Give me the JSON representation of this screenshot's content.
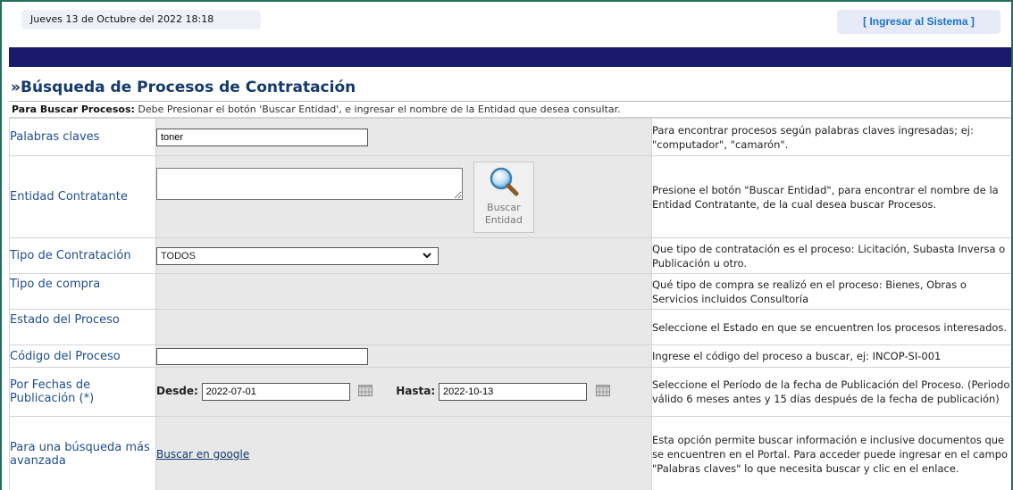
{
  "header": {
    "date_time": "Jueves 13 de Octubre del 2022 18:18",
    "login_label": "[ Ingresar al Sistema ]"
  },
  "page": {
    "title": "»Búsqueda de Procesos de Contratación",
    "instruction_bold": "Para Buscar Procesos:",
    "instruction_text": " Debe Presionar el botón 'Buscar Entidad', e ingresar el nombre de la Entidad que desea consultar."
  },
  "form": {
    "keywords": {
      "label": "Palabras claves",
      "value": "toner",
      "help": "Para encontrar procesos según palabras claves ingresadas; ej: \"computador\", \"camarón\"."
    },
    "entity": {
      "label": "Entidad Contratante",
      "value": "",
      "button_line1": "Buscar",
      "button_line2": "Entidad",
      "help": "Presione el botón \"Buscar Entidad\", para encontrar el nombre de la Entidad Contratante, de la cual desea buscar Procesos."
    },
    "contract_type": {
      "label": "Tipo de Contratación",
      "selected": "TODOS",
      "help": "Que tipo de contratación es el proceso: Licitación, Subasta Inversa o Publicación u otro."
    },
    "purchase_type": {
      "label": "Tipo de compra",
      "help": "Qué tipo de compra se realizó en el proceso: Bienes, Obras o Servicios incluidos Consultoría"
    },
    "process_state": {
      "label": "Estado del Proceso",
      "help": "Seleccione el Estado en que se encuentren los procesos interesados."
    },
    "process_code": {
      "label": "Código del Proceso",
      "value": "",
      "help": "Ingrese el código del proceso a buscar, ej: INCOP-SI-001"
    },
    "dates": {
      "label": "Por Fechas de Publicación (*)",
      "from_label": "Desde:",
      "from_value": "2022-07-01",
      "to_label": "Hasta:",
      "to_value": "2022-10-13",
      "help": "Seleccione el Período de la fecha de Publicación del Proceso. (Periodo válido 6 meses antes y 15 días después de la fecha de publicación)"
    },
    "advanced": {
      "label": "Para una búsqueda más avanzada",
      "link": "Buscar en google",
      "help": "Esta opción permite buscar información e inclusive documentos que se encuentren en el Portal. Para acceder puede ingresar en el campo \"Palabras claves\" lo que necesita buscar y clic en el enlace."
    }
  },
  "icons": {
    "search": "magnifier-icon",
    "calendar": "calendar-icon",
    "dropdown": "chevron-down-icon"
  },
  "colors": {
    "navbar": "#191970",
    "title": "#143a6e",
    "label": "#1f4e8c",
    "login": "#1a73c9",
    "control_bg": "#e8e8e8"
  }
}
